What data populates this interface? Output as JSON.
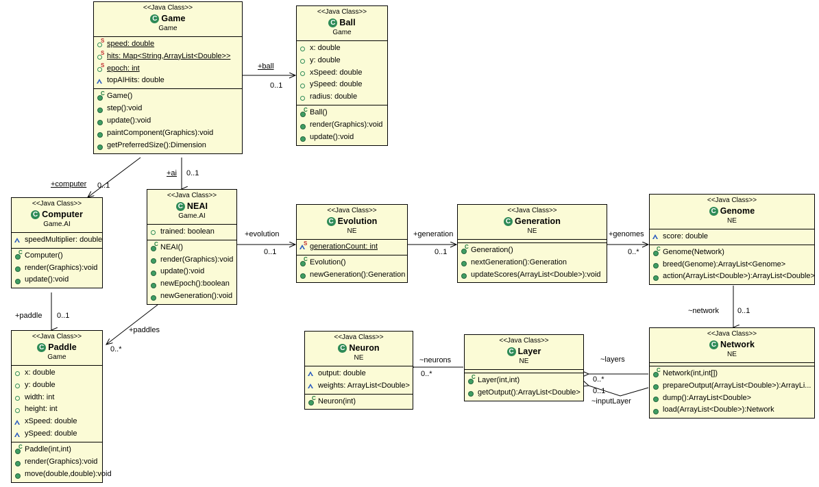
{
  "diagram": {
    "type": "UML Class Diagram",
    "stereotype_label": "<<Java Class>>",
    "background": "#ffffff",
    "class_fill": "#fbfbd6",
    "border_color": "#000000"
  },
  "classes": [
    {
      "id": "game",
      "stereotype": "<<Java Class>>",
      "name": "Game",
      "package": "Game",
      "attributes": [
        {
          "text": "speed: double",
          "icon": "field-public",
          "badge": "S",
          "static": true
        },
        {
          "text": "hits: Map<String,ArrayList<Double>>",
          "icon": "field-public",
          "badge": "S",
          "static": true
        },
        {
          "text": "epoch: int",
          "icon": "field-public",
          "badge": "S",
          "static": true
        },
        {
          "text": "topAIHits: double",
          "icon": "field-protected",
          "badge": "",
          "static": false
        }
      ],
      "methods": [
        {
          "text": "Game()",
          "icon": "method",
          "badge": "C"
        },
        {
          "text": "step():void",
          "icon": "method",
          "badge": ""
        },
        {
          "text": "update():void",
          "icon": "method",
          "badge": ""
        },
        {
          "text": "paintComponent(Graphics):void",
          "icon": "method",
          "badge": ""
        },
        {
          "text": "getPreferredSize():Dimension",
          "icon": "method",
          "badge": ""
        }
      ]
    },
    {
      "id": "ball",
      "stereotype": "<<Java Class>>",
      "name": "Ball",
      "package": "Game",
      "attributes": [
        {
          "text": "x: double",
          "icon": "field-public",
          "badge": ""
        },
        {
          "text": "y: double",
          "icon": "field-public",
          "badge": ""
        },
        {
          "text": "xSpeed: double",
          "icon": "field-public",
          "badge": ""
        },
        {
          "text": "ySpeed: double",
          "icon": "field-public",
          "badge": ""
        },
        {
          "text": "radius: double",
          "icon": "field-public",
          "badge": ""
        }
      ],
      "methods": [
        {
          "text": "Ball()",
          "icon": "method",
          "badge": "C"
        },
        {
          "text": "render(Graphics):void",
          "icon": "method",
          "badge": ""
        },
        {
          "text": "update():void",
          "icon": "method",
          "badge": ""
        }
      ]
    },
    {
      "id": "computer",
      "stereotype": "<<Java Class>>",
      "name": "Computer",
      "package": "Game.AI",
      "attributes": [
        {
          "text": "speedMultiplier: double",
          "icon": "field-protected",
          "badge": ""
        }
      ],
      "methods": [
        {
          "text": "Computer()",
          "icon": "method",
          "badge": "C"
        },
        {
          "text": "render(Graphics):void",
          "icon": "method",
          "badge": ""
        },
        {
          "text": "update():void",
          "icon": "method",
          "badge": ""
        }
      ]
    },
    {
      "id": "neai",
      "stereotype": "<<Java Class>>",
      "name": "NEAI",
      "package": "Game.AI",
      "attributes": [
        {
          "text": "trained: boolean",
          "icon": "field-public",
          "badge": ""
        }
      ],
      "methods": [
        {
          "text": "NEAI()",
          "icon": "method",
          "badge": "C"
        },
        {
          "text": "render(Graphics):void",
          "icon": "method",
          "badge": ""
        },
        {
          "text": "update():void",
          "icon": "method",
          "badge": ""
        },
        {
          "text": "newEpoch():boolean",
          "icon": "method",
          "badge": ""
        },
        {
          "text": "newGeneration():void",
          "icon": "method",
          "badge": ""
        }
      ]
    },
    {
      "id": "paddle",
      "stereotype": "<<Java Class>>",
      "name": "Paddle",
      "package": "Game",
      "attributes": [
        {
          "text": "x: double",
          "icon": "field-public",
          "badge": ""
        },
        {
          "text": "y: double",
          "icon": "field-public",
          "badge": ""
        },
        {
          "text": "width: int",
          "icon": "field-public",
          "badge": ""
        },
        {
          "text": "height: int",
          "icon": "field-public",
          "badge": ""
        },
        {
          "text": "xSpeed: double",
          "icon": "field-protected",
          "badge": ""
        },
        {
          "text": "ySpeed: double",
          "icon": "field-protected",
          "badge": ""
        }
      ],
      "methods": [
        {
          "text": "Paddle(int,int)",
          "icon": "method",
          "badge": "C"
        },
        {
          "text": "render(Graphics):void",
          "icon": "method",
          "badge": ""
        },
        {
          "text": "move(double,double):void",
          "icon": "method",
          "badge": ""
        }
      ]
    },
    {
      "id": "evolution",
      "stereotype": "<<Java Class>>",
      "name": "Evolution",
      "package": "NE",
      "attributes": [
        {
          "text": "generationCount: int",
          "icon": "field-protected",
          "badge": "S",
          "static": true
        }
      ],
      "methods": [
        {
          "text": "Evolution()",
          "icon": "method",
          "badge": "C"
        },
        {
          "text": "newGeneration():Generation",
          "icon": "method",
          "badge": ""
        }
      ]
    },
    {
      "id": "generation",
      "stereotype": "<<Java Class>>",
      "name": "Generation",
      "package": "NE",
      "attributes": [],
      "methods": [
        {
          "text": "Generation()",
          "icon": "method",
          "badge": "C"
        },
        {
          "text": "nextGeneration():Generation",
          "icon": "method",
          "badge": ""
        },
        {
          "text": "updateScores(ArrayList<Double>):void",
          "icon": "method",
          "badge": ""
        }
      ]
    },
    {
      "id": "genome",
      "stereotype": "<<Java Class>>",
      "name": "Genome",
      "package": "NE",
      "attributes": [
        {
          "text": "score: double",
          "icon": "field-protected",
          "badge": ""
        }
      ],
      "methods": [
        {
          "text": "Genome(Network)",
          "icon": "method",
          "badge": "C"
        },
        {
          "text": "breed(Genome):ArrayList<Genome>",
          "icon": "method",
          "badge": ""
        },
        {
          "text": "action(ArrayList<Double>):ArrayList<Double>",
          "icon": "method",
          "badge": ""
        }
      ]
    },
    {
      "id": "neuron",
      "stereotype": "<<Java Class>>",
      "name": "Neuron",
      "package": "NE",
      "attributes": [
        {
          "text": "output: double",
          "icon": "field-protected",
          "badge": ""
        },
        {
          "text": "weights: ArrayList<Double>",
          "icon": "field-protected",
          "badge": ""
        }
      ],
      "methods": [
        {
          "text": "Neuron(int)",
          "icon": "method",
          "badge": "C"
        }
      ]
    },
    {
      "id": "layer",
      "stereotype": "<<Java Class>>",
      "name": "Layer",
      "package": "NE",
      "attributes": [],
      "methods": [
        {
          "text": "Layer(int,int)",
          "icon": "method",
          "badge": "C"
        },
        {
          "text": "getOutput():ArrayList<Double>",
          "icon": "method",
          "badge": ""
        }
      ]
    },
    {
      "id": "network",
      "stereotype": "<<Java Class>>",
      "name": "Network",
      "package": "NE",
      "attributes": [],
      "methods": [
        {
          "text": "Network(int,int[])",
          "icon": "method",
          "badge": "C"
        },
        {
          "text": "prepareOutput(ArrayList<Double>):ArrayLi...",
          "icon": "method",
          "badge": ""
        },
        {
          "text": "dump():ArrayList<Double>",
          "icon": "method",
          "badge": ""
        },
        {
          "text": "load(ArrayList<Double>):Network",
          "icon": "method",
          "badge": ""
        }
      ]
    }
  ],
  "associations": [
    {
      "id": "ball",
      "role": "+ball",
      "multiplicity": "0..1",
      "from": "game",
      "to": "ball",
      "underlined": true
    },
    {
      "id": "computer",
      "role": "+computer",
      "multiplicity": "0..1",
      "from": "game",
      "to": "computer",
      "underlined": true
    },
    {
      "id": "ai",
      "role": "+ai",
      "multiplicity": "0..1",
      "from": "game",
      "to": "neai",
      "underlined": true
    },
    {
      "id": "paddle",
      "role": "+paddle",
      "multiplicity": "0..1",
      "from": "computer",
      "to": "paddle",
      "underlined": false
    },
    {
      "id": "paddles",
      "role": "+paddles",
      "multiplicity": "0..*",
      "from": "neai",
      "to": "paddle",
      "underlined": false
    },
    {
      "id": "evolution",
      "role": "+evolution",
      "multiplicity": "0..1",
      "from": "neai",
      "to": "evolution",
      "underlined": false
    },
    {
      "id": "generation",
      "role": "+generation",
      "multiplicity": "0..1",
      "from": "evolution",
      "to": "generation",
      "underlined": false
    },
    {
      "id": "genomes",
      "role": "+genomes",
      "multiplicity": "0..*",
      "from": "generation",
      "to": "genome",
      "underlined": false
    },
    {
      "id": "network",
      "role": "~network",
      "multiplicity": "0..1",
      "from": "genome",
      "to": "network",
      "underlined": false
    },
    {
      "id": "layers",
      "role": "~layers",
      "multiplicity": "0..*",
      "from": "network",
      "to": "layer",
      "underlined": false
    },
    {
      "id": "inputlayer",
      "role": "~inputLayer",
      "multiplicity": "0..1",
      "from": "network",
      "to": "layer",
      "underlined": false
    },
    {
      "id": "neurons",
      "role": "~neurons",
      "multiplicity": "0..*",
      "from": "layer",
      "to": "neuron",
      "underlined": false
    }
  ]
}
